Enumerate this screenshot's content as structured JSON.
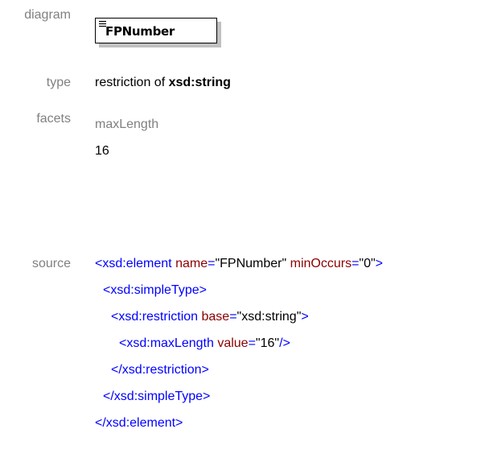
{
  "labels": {
    "diagram": "diagram",
    "type": "type",
    "facets": "facets",
    "source": "source"
  },
  "diagram": {
    "element_name": "FPNumber",
    "icon": "lines-icon"
  },
  "type": {
    "prefix": "restriction of ",
    "base": "xsd:string"
  },
  "facets": {
    "name": "maxLength",
    "value": "16"
  },
  "source": {
    "line1": {
      "open": "<xsd:element",
      "attr1_name": "name",
      "eq1": "=",
      "attr1_value": "\"FPNumber\"",
      "attr2_name": "minOccurs",
      "eq2": "=",
      "attr2_value": "\"0\"",
      "close": ">"
    },
    "line2": {
      "tag": "<xsd:simpleType>"
    },
    "line3": {
      "open": "<xsd:restriction",
      "attr_name": "base",
      "eq": "=",
      "attr_value": "\"xsd:string\"",
      "close": ">"
    },
    "line4": {
      "open": "<xsd:maxLength",
      "attr_name": "value",
      "eq": "=",
      "attr_value": "\"16\"",
      "close": "/>"
    },
    "line5": {
      "tag": "</xsd:restriction>"
    },
    "line6": {
      "tag": "</xsd:simpleType>"
    },
    "line7": {
      "tag": "</xsd:element>"
    }
  },
  "colors": {
    "label": "#808080",
    "tag": "#0000ff",
    "attribute": "#8b0000",
    "value": "#000000",
    "shadow": "#c0c0c0"
  }
}
